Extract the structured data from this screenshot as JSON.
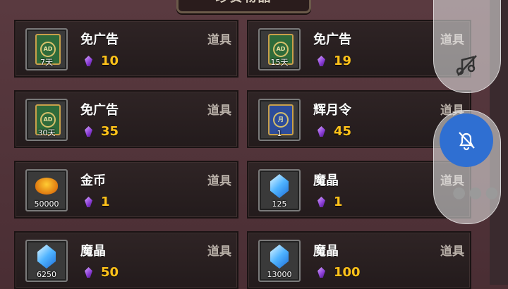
{
  "title": "珍贵物品",
  "items": [
    {
      "name": "免广告",
      "tag": "道具",
      "price": "10",
      "icon": "ad-card-icon",
      "icon_label": "AD",
      "qty": "7天"
    },
    {
      "name": "免广告",
      "tag": "道具",
      "price": "19",
      "icon": "ad-card-icon",
      "icon_label": "AD",
      "qty": "15天"
    },
    {
      "name": "免广告",
      "tag": "道具",
      "price": "35",
      "icon": "ad-card-icon",
      "icon_label": "AD",
      "qty": "30天"
    },
    {
      "name": "辉月令",
      "tag": "道具",
      "price": "45",
      "icon": "moon-token-icon",
      "icon_label": "月",
      "qty": "1"
    },
    {
      "name": "金币",
      "tag": "道具",
      "price": "1",
      "icon": "gold-coin-icon",
      "qty": "50000"
    },
    {
      "name": "魔晶",
      "tag": "道具",
      "price": "1",
      "icon": "magic-crystal-icon",
      "qty": "125"
    },
    {
      "name": "魔晶",
      "tag": "道具",
      "price": "50",
      "icon": "magic-crystal-icon",
      "qty": "6250"
    },
    {
      "name": "魔晶",
      "tag": "道具",
      "price": "100",
      "icon": "magic-crystal-icon",
      "qty": "13000"
    }
  ],
  "colors": {
    "price": "#ffc21a",
    "accent_blue": "#2f6fd2"
  }
}
